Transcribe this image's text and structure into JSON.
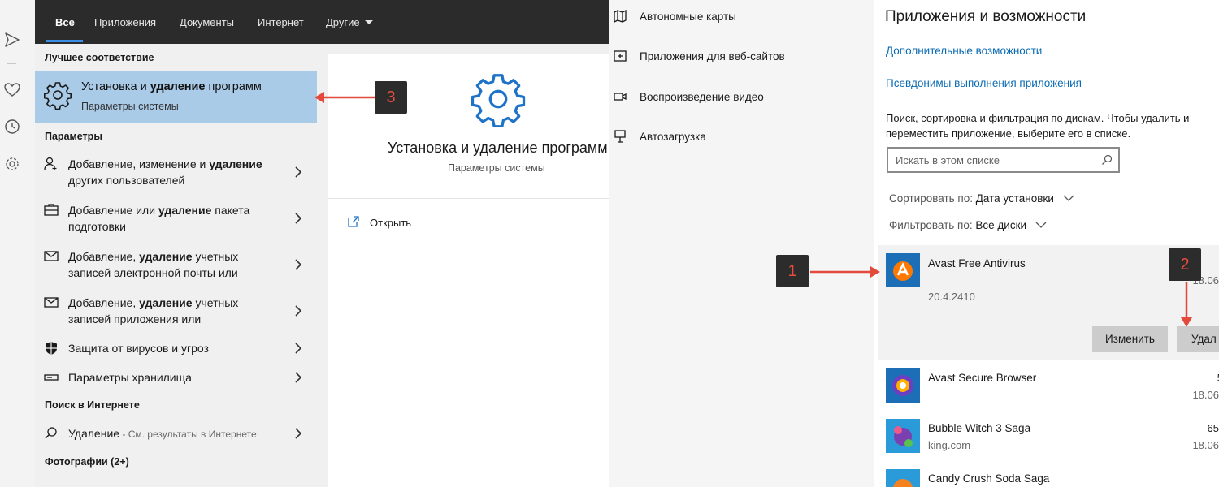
{
  "rail": {
    "icons": [
      "send-icon",
      "heart-icon",
      "history-icon",
      "settings-icon"
    ]
  },
  "search": {
    "tabs": [
      {
        "label": "Все",
        "active": true
      },
      {
        "label": "Приложения"
      },
      {
        "label": "Документы"
      },
      {
        "label": "Интернет"
      },
      {
        "label": "Другие"
      }
    ],
    "best_match_heading": "Лучшее соответствие",
    "best_match": {
      "title_plain": "Установка и ",
      "title_bold": "удаление",
      "title_tail": " программ",
      "subtitle": "Параметры системы"
    },
    "settings_heading": "Параметры",
    "results": [
      {
        "icon": "person-icon",
        "pre": "Добавление, изменение и ",
        "bold": "удаление",
        "post": " других пользователей"
      },
      {
        "icon": "briefcase-icon",
        "pre": "Добавление или ",
        "bold": "удаление",
        "post": " пакета подготовки"
      },
      {
        "icon": "mail-icon",
        "pre": "Добавление, ",
        "bold": "удаление",
        "post": " учетных записей электронной почты или"
      },
      {
        "icon": "mail-icon",
        "pre": "Добавление, ",
        "bold": "удаление",
        "post": " учетных записей приложения или"
      },
      {
        "icon": "shield-icon",
        "pre": "Защита от вирусов и угроз",
        "bold": "",
        "post": ""
      },
      {
        "icon": "storage-icon",
        "pre": "Параметры хранилища",
        "bold": "",
        "post": ""
      }
    ],
    "web_heading": "Поиск в Интернете",
    "web_result": {
      "label": "Удаление",
      "sub": " - См. результаты в Интернете"
    },
    "photos_heading": "Фотографии (2+)",
    "preview": {
      "title": "Установка и удаление программ",
      "subtitle": "Параметры системы",
      "open_label": "Открыть"
    }
  },
  "settings_nav": {
    "items": [
      {
        "icon": "map-icon",
        "label": "Автономные карты"
      },
      {
        "icon": "web-apps-icon",
        "label": "Приложения для веб-сайтов"
      },
      {
        "icon": "video-icon",
        "label": "Воспроизведение видео"
      },
      {
        "icon": "startup-icon",
        "label": "Автозагрузка"
      }
    ]
  },
  "apps": {
    "title": "Приложения и возможности",
    "link1": "Дополнительные возможности",
    "link2": "Псевдонимы выполнения приложения",
    "desc_line1": "Поиск, сортировка и фильтрация по дискам. Чтобы удалить и",
    "desc_line2": "переместить приложение, выберите его в списке.",
    "search_placeholder": "Искать в этом списке",
    "sort_label": "Сортировать по:",
    "sort_value": "Дата установки",
    "filter_label": "Фильтровать по:",
    "filter_value": "Все диски",
    "list": [
      {
        "name": "Avast Free Antivirus",
        "version": "20.4.2410",
        "date": "18.06",
        "selected": true,
        "modify": "Изменить",
        "uninstall": "Удал"
      },
      {
        "name": "Avast Secure Browser",
        "size": "5",
        "date": "18.06"
      },
      {
        "name": "Bubble Witch 3 Saga",
        "publisher": "king.com",
        "size": "65",
        "date": "18.06"
      },
      {
        "name": "Candy Crush Soda Saga"
      }
    ]
  },
  "callouts": [
    "1",
    "2",
    "3"
  ],
  "colors": {
    "tabbar": "#2b2b2b",
    "accent": "#3a8ee6",
    "best_match_bg": "#a9cbe8",
    "link": "#0a6bb3",
    "callout_text": "#e84c3d",
    "arrow": "#e34a3b"
  }
}
